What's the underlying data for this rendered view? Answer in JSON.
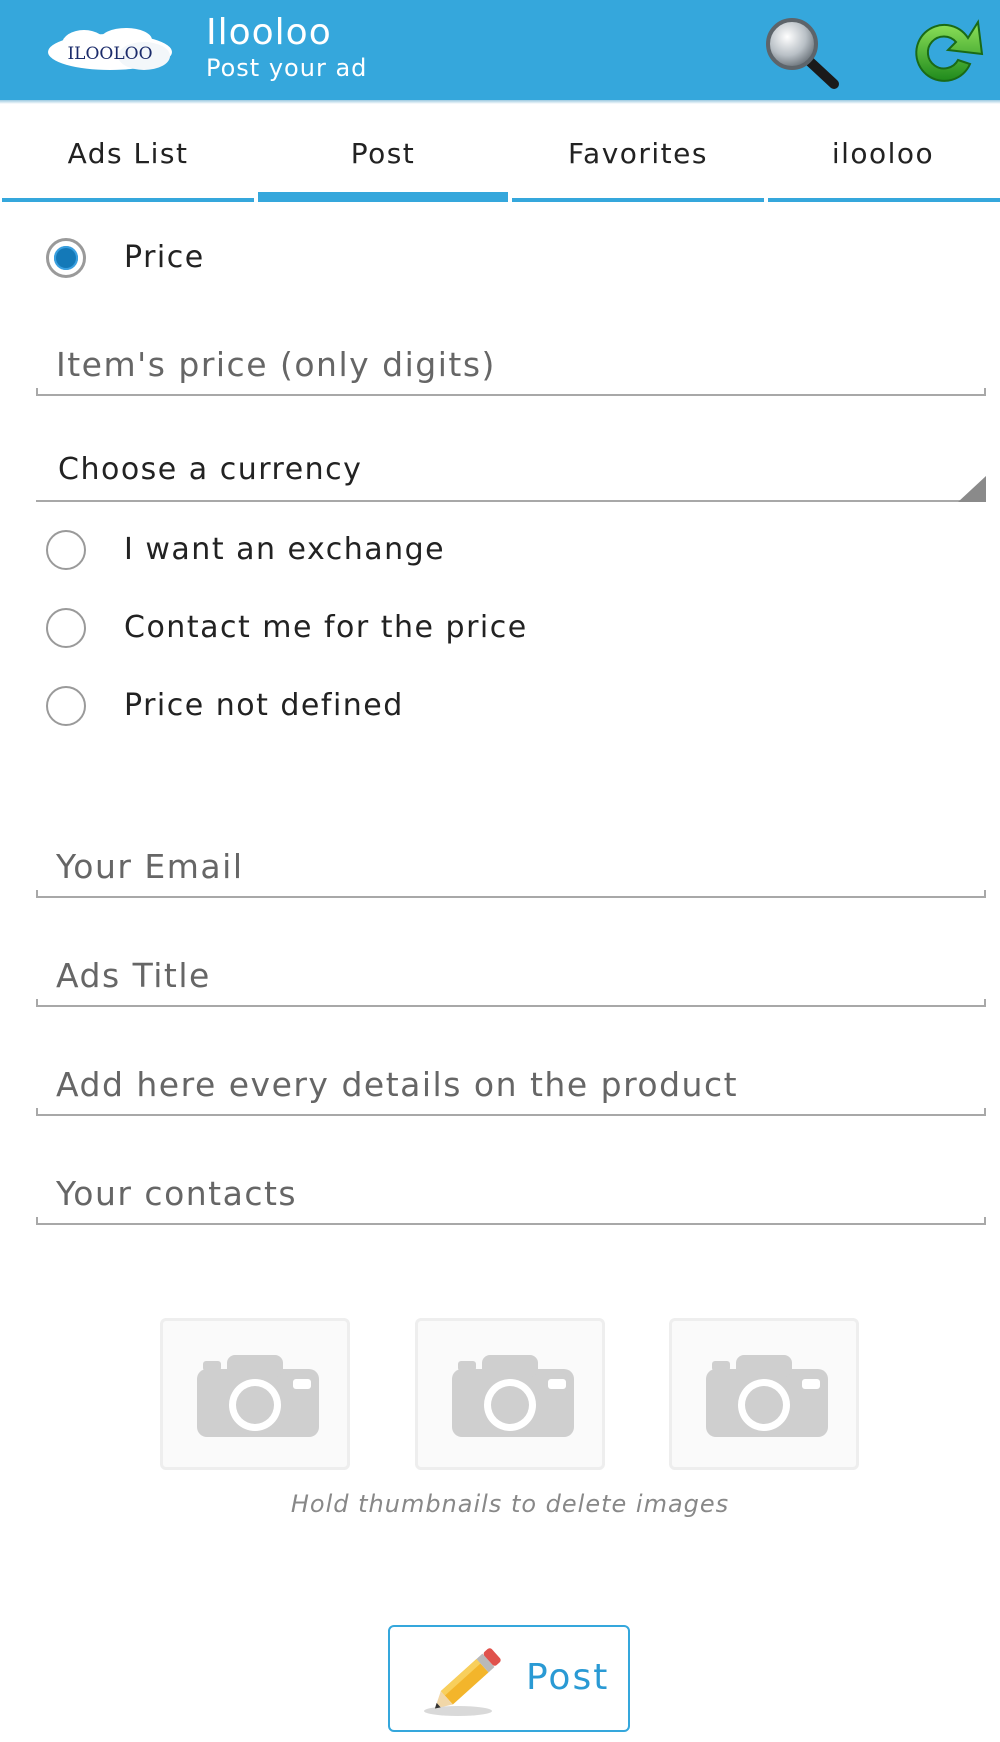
{
  "app": {
    "title": "Ilooloo",
    "subtitle": "Post your ad",
    "logo_text": "ILOOLOO",
    "colors": {
      "bar": "#35a7dc",
      "accent": "#1479b8"
    },
    "actions": [
      {
        "name": "search-icon"
      },
      {
        "name": "refresh-icon"
      }
    ]
  },
  "tabs": [
    {
      "label": "Ads List",
      "active": false
    },
    {
      "label": "Post",
      "active": true
    },
    {
      "label": "Favorites",
      "active": false
    },
    {
      "label": "ilooloo",
      "active": false
    }
  ],
  "price_options": {
    "price_label": "Price",
    "price_placeholder": "Item's price (only digits)",
    "currency_label": "Choose a currency",
    "exchange_label": "I want an exchange",
    "contact_label": "Contact me for the price",
    "undefined_label": "Price not defined",
    "selected": "Price"
  },
  "form": {
    "email_placeholder": "Your Email",
    "title_placeholder": "Ads Title",
    "details_placeholder": "Add here every details on the product",
    "contacts_placeholder": "Your contacts"
  },
  "photos": {
    "slots": [
      "camera-icon",
      "camera-icon",
      "camera-icon"
    ],
    "hint": "Hold thumbnails to delete images"
  },
  "post_button": {
    "label": "Post",
    "icon": "pencil-icon"
  }
}
